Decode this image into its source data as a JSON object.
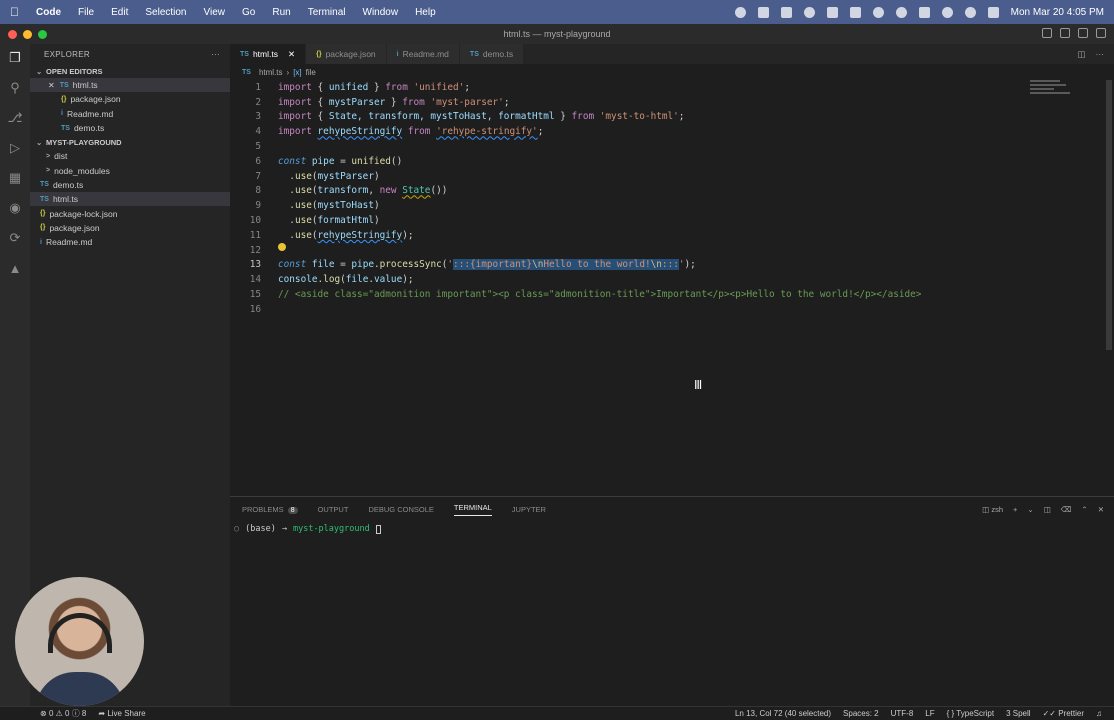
{
  "menubar": {
    "app": "Code",
    "items": [
      "File",
      "Edit",
      "Selection",
      "View",
      "Go",
      "Run",
      "Terminal",
      "Window",
      "Help"
    ],
    "datetime": "Mon Mar 20  4:05 PM"
  },
  "window": {
    "title": "html.ts — myst-playground"
  },
  "explorer": {
    "header": "EXPLORER",
    "open_editors_title": "OPEN EDITORS",
    "open_editors": [
      {
        "icon": "TS",
        "name": "html.ts"
      },
      {
        "icon": "{}",
        "name": "package.json"
      },
      {
        "icon": "i",
        "name": "Readme.md"
      },
      {
        "icon": "TS",
        "name": "demo.ts"
      }
    ],
    "project_title": "MYST-PLAYGROUND",
    "project_items": [
      {
        "icon": ">",
        "name": "dist"
      },
      {
        "icon": ">",
        "name": "node_modules"
      },
      {
        "icon": "TS",
        "name": "demo.ts"
      },
      {
        "icon": "TS",
        "name": "html.ts"
      },
      {
        "icon": "{}",
        "name": "package-lock.json"
      },
      {
        "icon": "{}",
        "name": "package.json"
      },
      {
        "icon": "i",
        "name": "Readme.md"
      }
    ]
  },
  "tabs": [
    {
      "icon": "TS",
      "label": "html.ts"
    },
    {
      "icon": "{}",
      "label": "package.json"
    },
    {
      "icon": "i",
      "label": "Readme.md"
    },
    {
      "icon": "TS",
      "label": "demo.ts"
    }
  ],
  "breadcrumb": {
    "file": "html.ts",
    "symbol": "file"
  },
  "code": {
    "line_numbers": [
      "1",
      "2",
      "3",
      "4",
      "5",
      "6",
      "7",
      "8",
      "9",
      "10",
      "11",
      "12",
      "13",
      "14",
      "15",
      "16"
    ],
    "l1": {
      "kw": "import",
      "a": " { ",
      "v": "unified",
      "b": " } ",
      "from": "from",
      "s": "'unified'",
      "e": ";"
    },
    "l2": {
      "kw": "import",
      "a": " { ",
      "v": "mystParser",
      "b": " } ",
      "from": "from",
      "s": "'myst-parser'",
      "e": ";"
    },
    "l3": {
      "kw": "import",
      "a": " { ",
      "v": "State, transform, mystToHast, formatHtml",
      "b": " } ",
      "from": "from",
      "s": "'myst-to-html'",
      "e": ";"
    },
    "l4": {
      "kw": "import",
      "v": "rehypeStringify",
      "from": "from",
      "s": "'rehype-stringify'",
      "e": ";"
    },
    "l6": {
      "kw": "const",
      "v": "pipe",
      "eq": " = ",
      "fn": "unified",
      "p": "()"
    },
    "l7": {
      "dot": "  .",
      "fn": "use",
      "a": "(",
      "v": "mystParser",
      "b": ")"
    },
    "l8": {
      "dot": "  .",
      "fn": "use",
      "a": "(",
      "v": "transform",
      "c": ", ",
      "nw": "new",
      "cls": "State",
      "b": "())"
    },
    "l9": {
      "dot": "  .",
      "fn": "use",
      "a": "(",
      "v": "mystToHast",
      "b": ")"
    },
    "l10": {
      "dot": "  .",
      "fn": "use",
      "a": "(",
      "v": "formatHtml",
      "b": ")"
    },
    "l11": {
      "dot": "  .",
      "fn": "use",
      "a": "(",
      "v": "rehypeStringify",
      "b": ");"
    },
    "l13": {
      "kw": "const",
      "v": "file",
      "eq": " = ",
      "v2": "pipe",
      "dot": ".",
      "fn": "processSync",
      "a": "(",
      "q1": "'",
      "s1": ":::{important}",
      "e1": "\\n",
      "s2": "Hello to the world!",
      "e2": "\\n",
      "s3": ":::",
      "q2": "'",
      "b": ");"
    },
    "l14": {
      "v": "console",
      "dot": ".",
      "fn": "log",
      "a": "(",
      "v2": "file",
      "dot2": ".",
      "v3": "value",
      "b": ");"
    },
    "l15": {
      "cmt": "// <aside class=\"admonition important\"><p class=\"admonition-title\">Important</p><p>Hello to the world!</p></aside>"
    }
  },
  "panel": {
    "tabs": [
      "PROBLEMS",
      "OUTPUT",
      "DEBUG CONSOLE",
      "TERMINAL",
      "JUPYTER"
    ],
    "problems_count": "8",
    "shell": "zsh",
    "terminal": {
      "env": "(base)",
      "arrow": "→",
      "dir": "myst-playground"
    }
  },
  "status": {
    "errors": "0",
    "warnings": "0",
    "info": "8",
    "live_share": "Live Share",
    "position": "Ln 13, Col 72 (40 selected)",
    "spaces": "Spaces: 2",
    "encoding": "UTF-8",
    "eol": "LF",
    "language": "TypeScript",
    "spell": "3 Spell",
    "prettier": "Prettier"
  }
}
